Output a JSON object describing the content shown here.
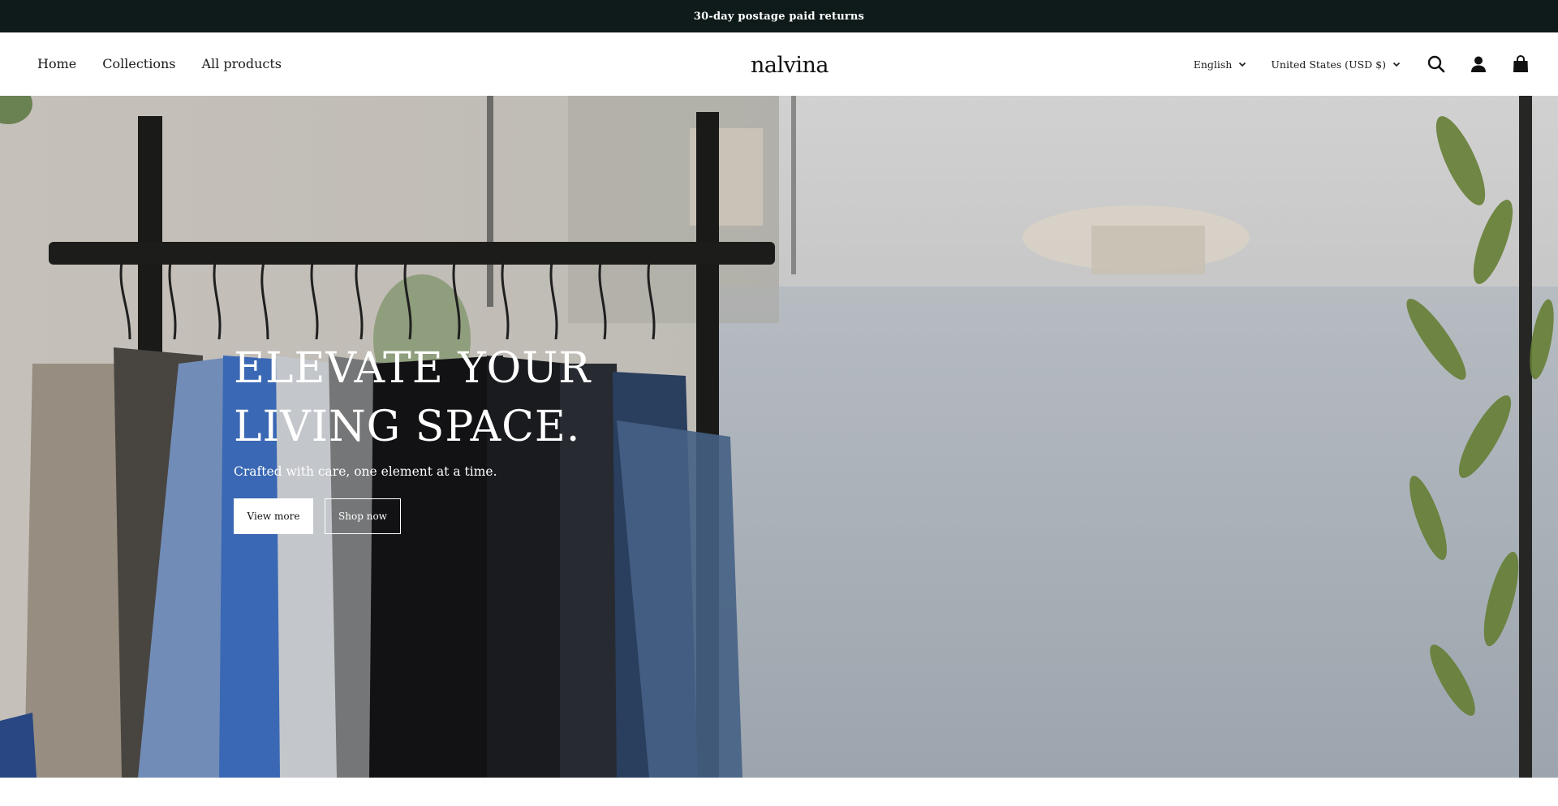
{
  "announcement": {
    "text": "30-day postage paid returns"
  },
  "header": {
    "nav": [
      {
        "label": "Home"
      },
      {
        "label": "Collections"
      },
      {
        "label": "All products"
      }
    ],
    "logo_text": "nalvina",
    "language": {
      "selected": "English"
    },
    "country": {
      "selected": "United States (USD $)"
    },
    "icons": [
      "search-icon",
      "account-icon",
      "cart-icon"
    ]
  },
  "hero": {
    "title_line1": "ELEVATE YOUR",
    "title_line2": "LIVING SPACE.",
    "subtitle": "Crafted with care, one element at a time.",
    "primary_button": "View more",
    "secondary_button": "Shop now"
  },
  "colors": {
    "announcement_bg": "#0e1b1a",
    "header_bg": "#ffffff",
    "text": "#121212",
    "hero_text": "#ffffff"
  }
}
